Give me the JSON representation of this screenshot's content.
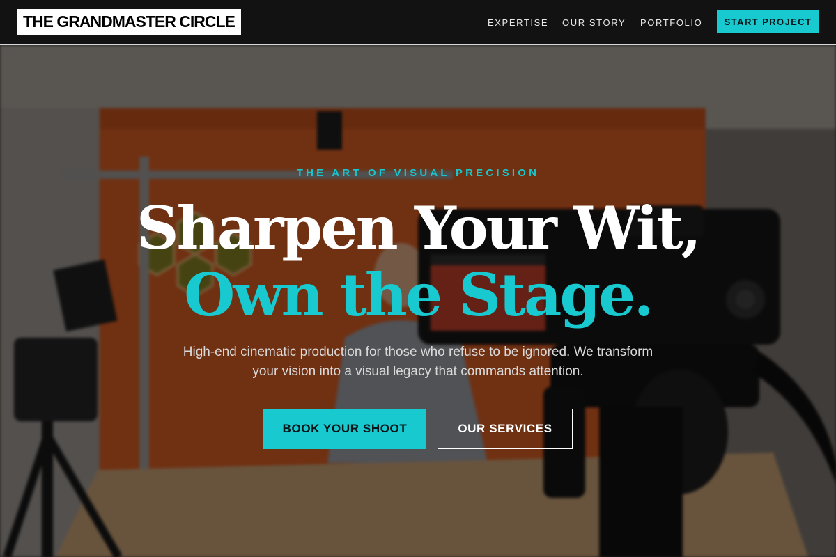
{
  "brand": {
    "logo_text": "THE GRANDMASTER CIRCLE"
  },
  "nav": {
    "links": [
      {
        "label": "EXPERTISE"
      },
      {
        "label": "OUR STORY"
      },
      {
        "label": "PORTFOLIO"
      }
    ],
    "cta_label": "START PROJECT"
  },
  "hero": {
    "eyebrow": "THE ART OF VISUAL PRECISION",
    "headline_line1": "Sharpen Your Wit,",
    "headline_line2": "Own the Stage.",
    "subtext": "High-end cinematic production for those who refuse to be ignored. We transform your vision into a visual legacy that commands attention.",
    "primary_button": "BOOK YOUR SHOOT",
    "secondary_button": "OUR SERVICES"
  },
  "colors": {
    "accent": "#18c9d0",
    "header_bg": "#121212",
    "overlay": "rgba(0,0,0,0.42)"
  }
}
